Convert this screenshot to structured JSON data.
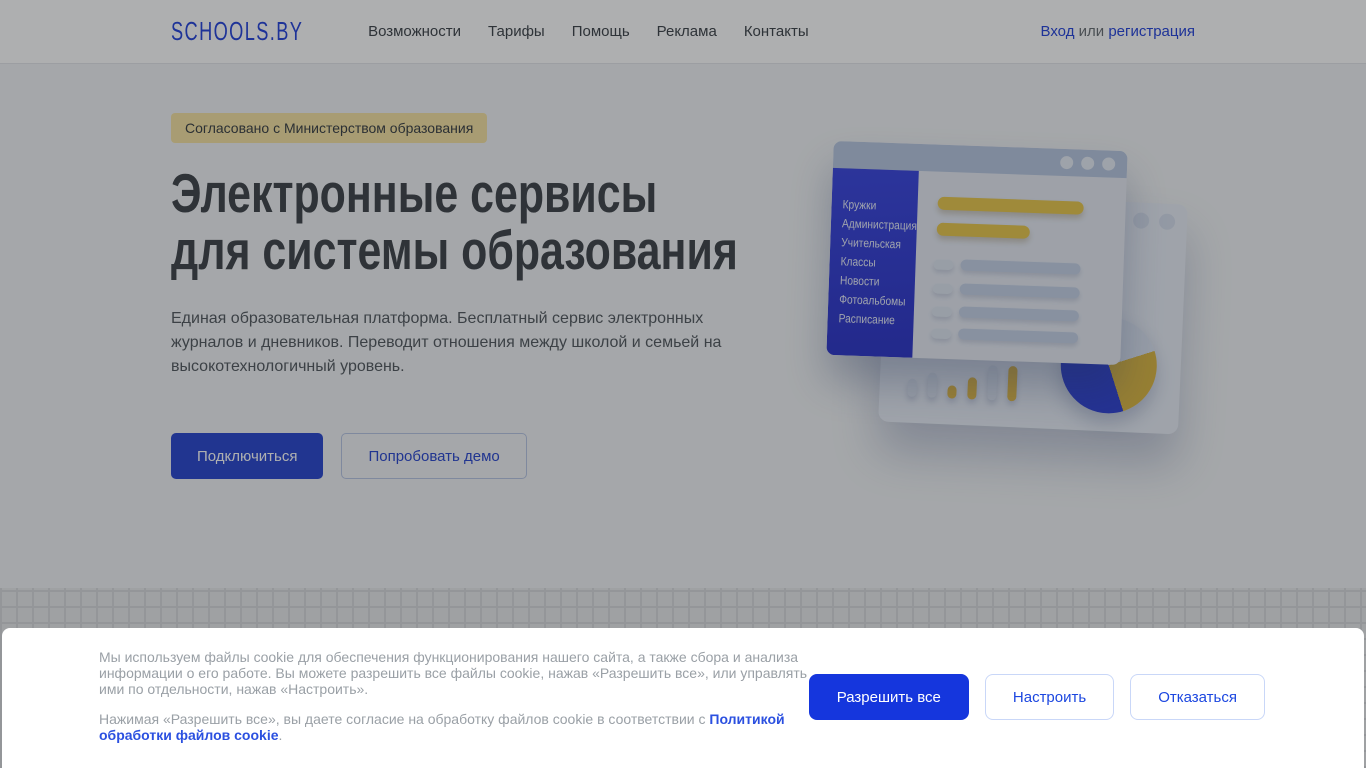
{
  "brand": {
    "logo": "SCHOOLS.BY"
  },
  "nav": {
    "items": [
      "Возможности",
      "Тарифы",
      "Помощь",
      "Реклама",
      "Контакты"
    ],
    "auth": {
      "login": "Вход",
      "or": "или",
      "register": "регистрация"
    }
  },
  "hero": {
    "badge": "Согласовано с Министерством образования",
    "title_line1": "Электронные сервисы",
    "title_line2": "для системы образования",
    "description": "Единая образовательная платформа. Бесплатный сервис электронных журналов и дневников. Переводит отношения между школой и семьей на высокотехнологичный уровень.",
    "cta_primary": "Подключиться",
    "cta_secondary": "Попробовать демо"
  },
  "illustration": {
    "sidebar_items": [
      "Кружки",
      "Администрация",
      "Учительская",
      "Классы",
      "Новости",
      "Фотоальбомы",
      "Расписание"
    ]
  },
  "cookie": {
    "paragraph1": "Мы используем файлы cookie для обеспечения функционирования нашего сайта, а также сбора и анализа информации о его работе. Вы можете разрешить все файлы cookie, нажав «Разрешить все», или управлять ими по отдельности, нажав «Настроить».",
    "paragraph2_prefix": "Нажимая «Разрешить все», вы даете согласие на обработку файлов cookie в соответствии с ",
    "policy_link": "Политикой обработки файлов cookie",
    "paragraph2_suffix": ".",
    "buttons": {
      "accept": "Разрешить все",
      "configure": "Настроить",
      "decline": "Отказаться"
    }
  },
  "colors": {
    "accent_blue": "#2946db",
    "primary_button_blue": "#2d49d0",
    "cookie_button_blue": "#1536dd",
    "badge_background": "#f6e3a4",
    "illustration_sidebar_blue": "#3e49e0",
    "illustration_yellow": "#e9c84f"
  }
}
